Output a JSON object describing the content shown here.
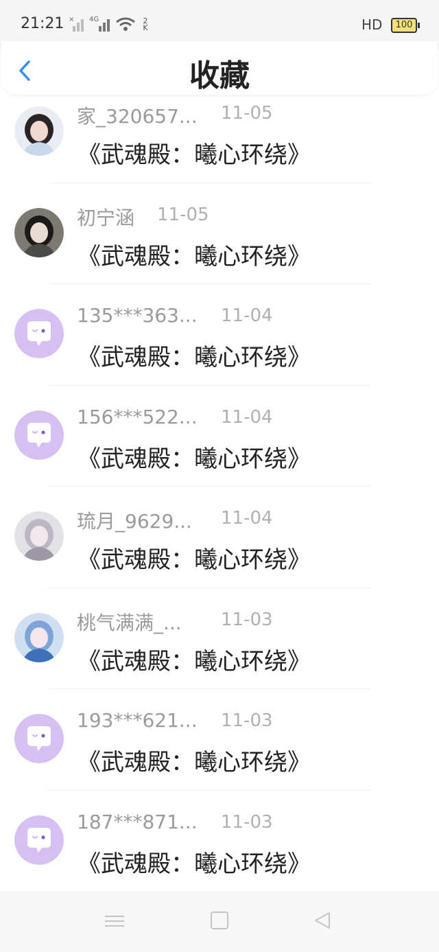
{
  "status_bar": {
    "time": "21:21",
    "network": "4G",
    "rate": "2 K",
    "hd": "HD",
    "battery": "100",
    "icons": [
      "signal-x-icon",
      "signal-4g-icon",
      "wifi-icon"
    ]
  },
  "header": {
    "title": "收藏",
    "back_icon": "chevron-left-icon",
    "accent_color": "#2f8ef0"
  },
  "favorites": [
    {
      "user": "家_320657...",
      "date": "11-05",
      "title": "《武魂殿：曦心环绕》",
      "avatar": "photo-girl-peace-sign"
    },
    {
      "user": "初宁涵",
      "date": "11-05",
      "title": "《武魂殿：曦心环绕》",
      "avatar": "photo-girl-dark"
    },
    {
      "user": "135***363...",
      "date": "11-04",
      "title": "《武魂殿：曦心环绕》",
      "avatar": "default-chat-bubble"
    },
    {
      "user": "156***522...",
      "date": "11-04",
      "title": "《武魂殿：曦心环绕》",
      "avatar": "default-chat-bubble"
    },
    {
      "user": "琉月_9629...",
      "date": "11-04",
      "title": "《武魂殿：曦心环绕》",
      "avatar": "photo-girl-silver-hair"
    },
    {
      "user": "桃气满满_...",
      "date": "11-03",
      "title": "《武魂殿：曦心环绕》",
      "avatar": "photo-anime-blue"
    },
    {
      "user": "193***621...",
      "date": "11-03",
      "title": "《武魂殿：曦心环绕》",
      "avatar": "default-chat-bubble"
    },
    {
      "user": "187***871...",
      "date": "11-03",
      "title": "《武魂殿：曦心环绕》",
      "avatar": "default-chat-bubble"
    }
  ],
  "default_avatar_color": "#d6bff2",
  "nav_bar": {
    "icons": [
      "menu-icon",
      "home-square-icon",
      "back-triangle-icon"
    ]
  }
}
